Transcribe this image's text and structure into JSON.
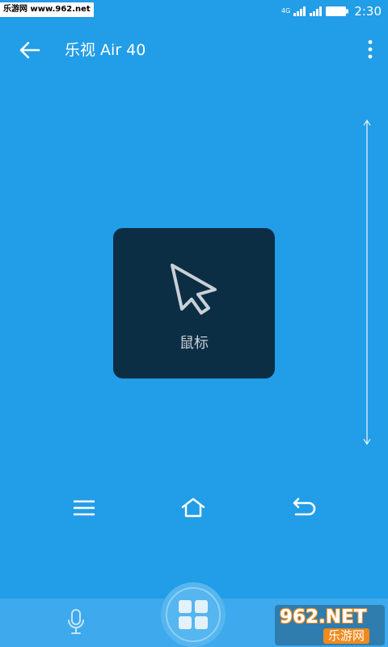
{
  "status_bar": {
    "watermark_text": "乐游网 www.962.net",
    "network_type": "4G",
    "time": "2:30",
    "icons": [
      "signal-4g-icon",
      "signal-icon",
      "battery-icon"
    ]
  },
  "app_bar": {
    "title": "乐视 Air 40",
    "back_icon": "arrow-left-icon",
    "menu_icon": "more-vertical-icon"
  },
  "remote": {
    "scroll_icon": "vertical-scroll-icon",
    "mode_card": {
      "icon": "mouse-cursor-icon",
      "label": "鼠标"
    },
    "controls": [
      "menu-icon",
      "home-icon",
      "return-icon"
    ]
  },
  "bottom_bar": {
    "left_icon": "microphone-icon",
    "center_icon": "app-grid-icon"
  },
  "logo_watermark": {
    "brand": "962.NET",
    "name": "乐游网"
  },
  "colors": {
    "background": "#229de7",
    "card": "#0c2e45",
    "bottom_bar": "#3ea9ec",
    "icon": "#ffffff",
    "card_icon": "#c9d1d6"
  }
}
